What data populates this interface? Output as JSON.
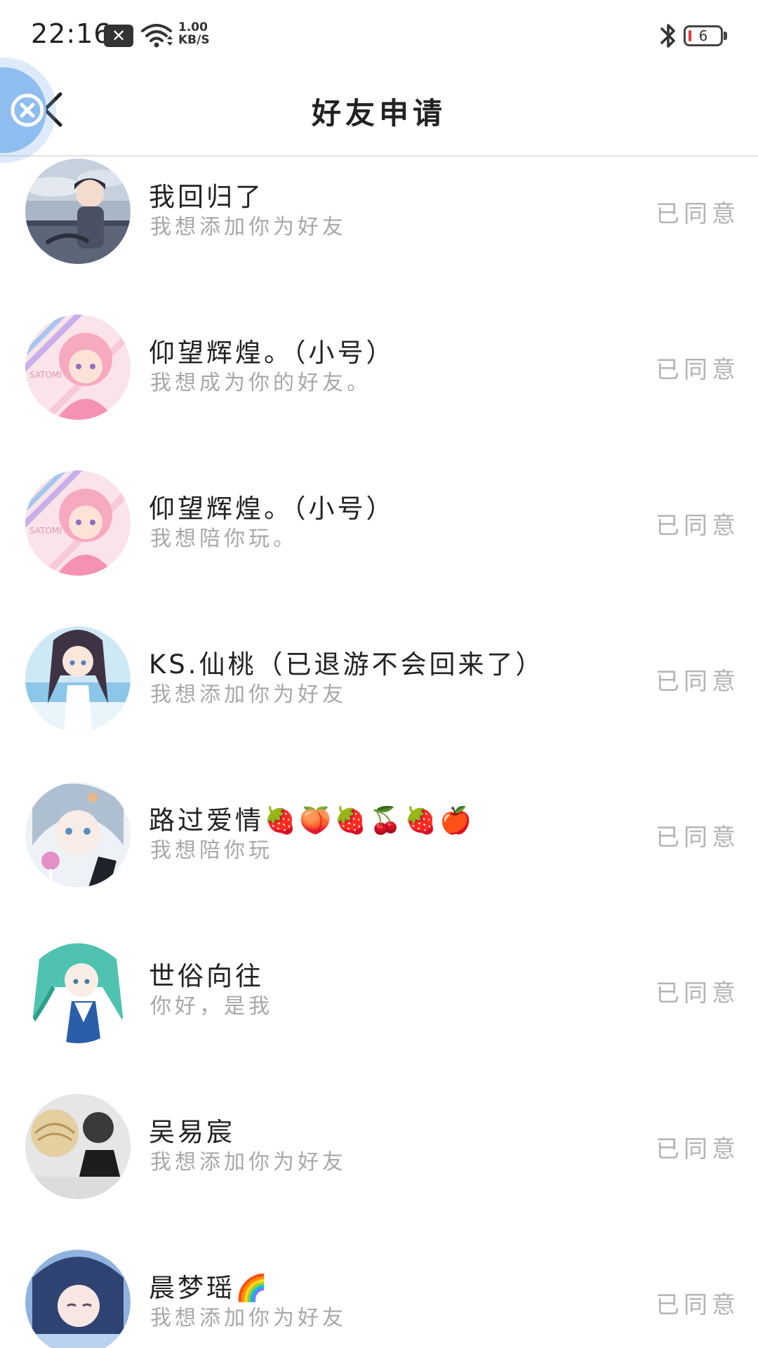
{
  "status_bar": {
    "time": "22:16",
    "notification_icon": "close-x",
    "net_speed_value": "1.00",
    "net_speed_unit": "KB/S",
    "battery_level": "6",
    "battery_color": "#e53935"
  },
  "header": {
    "title": "好友申请",
    "back_icon": "chevron-left"
  },
  "requests": [
    {
      "name": "我回归了",
      "message": "我想添加你为好友",
      "status": "已同意",
      "avatar": "boy-sky"
    },
    {
      "name": "仰望辉煌。（小号）",
      "message": "我想成为你的好友。",
      "status": "已同意",
      "avatar": "pink-hair"
    },
    {
      "name": "仰望辉煌。（小号）",
      "message": "我想陪你玩。",
      "status": "已同意",
      "avatar": "pink-hair"
    },
    {
      "name": "KS.仙桃（已退游不会回来了）",
      "message": "我想添加你为好友",
      "status": "已同意",
      "avatar": "girl-sea"
    },
    {
      "name": "路过爱情🍓🍑🍓🍒🍓🍎",
      "message": "我想陪你玩",
      "status": "已同意",
      "avatar": "silver-hair"
    },
    {
      "name": "世俗向往",
      "message": "你好，是我",
      "status": "已同意",
      "avatar": "green-hair"
    },
    {
      "name": "吴易宸",
      "message": "我想添加你为好友",
      "status": "已同意",
      "avatar": "meme-pancake"
    },
    {
      "name": "晨梦瑶🌈",
      "message": "我想添加你为好友",
      "status": "已同意",
      "avatar": "blue-hair"
    }
  ]
}
